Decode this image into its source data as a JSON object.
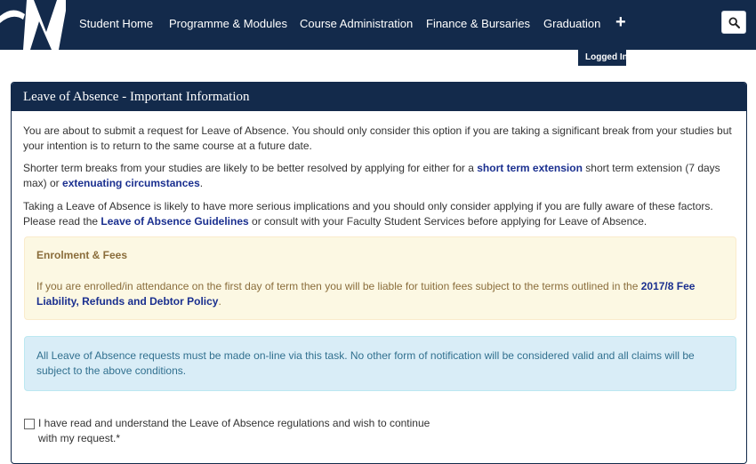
{
  "nav": {
    "items": [
      "Student Home",
      "Programme & Modules",
      "Course Administration",
      "Finance & Bursaries",
      "Graduation"
    ],
    "plus": "+",
    "logged_in": "Logged In"
  },
  "panel": {
    "heading": "Leave of Absence - Important Information",
    "intro": "You are about to submit a request for Leave of Absence. You should only consider this option if you are taking a significant break from your studies but your intention is to return to the same course at a future date.",
    "shorter": {
      "before": "Shorter term breaks from your studies are likely to be better resolved by applying for either for a ",
      "link_extension": "short term extension",
      "middle": " short term extension (7 days max) or ",
      "link_circumstances": "extenuating circumstances",
      "end": "."
    },
    "taking": {
      "before": "Taking a Leave of Absence is likely to have more serious implications and you should only consider applying if you are fully aware of these factors. Please read the ",
      "link_guidelines": "Leave of Absence Guidelines",
      "after": " or consult with your Faculty Student Services before applying for Leave of Absence."
    },
    "warning": {
      "title": "Enrolment & Fees",
      "text_before": "If you are enrolled/in attendance on the first day of term then you will be liable for tuition fees subject to the terms outlined in the ",
      "link_policy": "2017/8 Fee Liability, Refunds and Debtor Policy",
      "text_after": "."
    },
    "info": "All Leave of Absence requests must be made on-line via this task. No other form of notification will be considered valid and all claims will be subject to the above conditions.",
    "consent": "I have read and understand the Leave of Absence regulations and wish to continue with my request.*"
  },
  "colors": {
    "nav_bg": "#132a4b",
    "link": "#1a2f8f",
    "warning_bg": "#fcf8e3",
    "info_bg": "#d9edf7"
  },
  "icons": [
    "logo-icon",
    "plus-icon",
    "search-icon"
  ]
}
